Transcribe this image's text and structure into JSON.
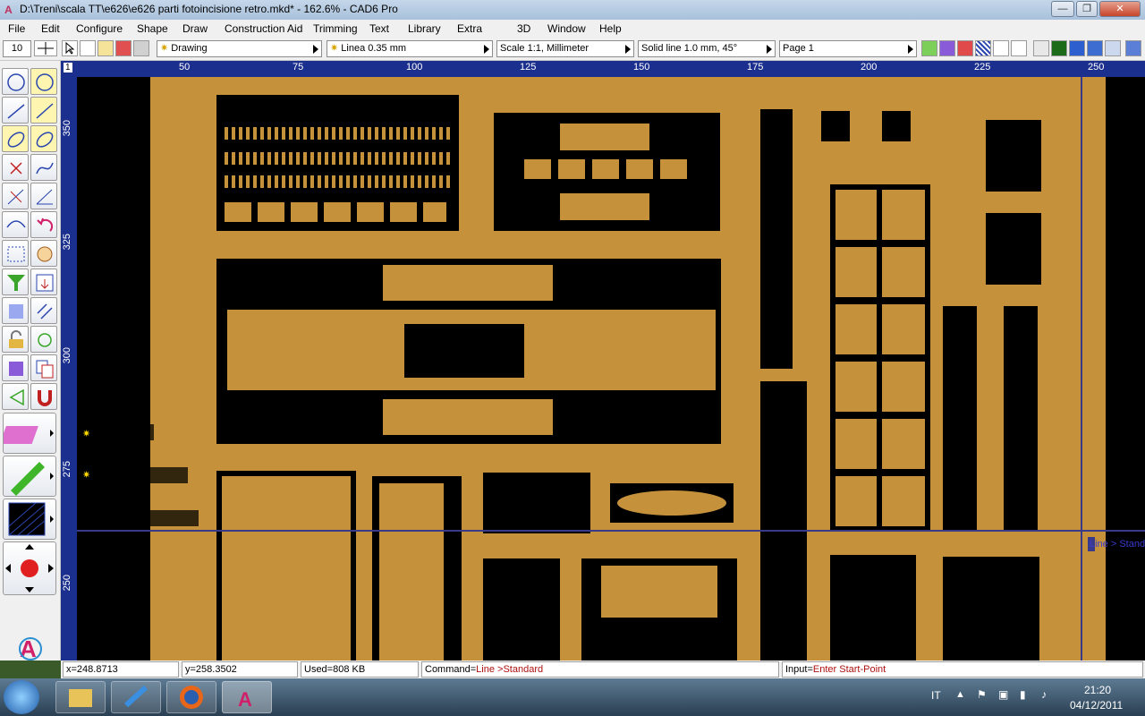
{
  "window": {
    "title": "D:\\Treni\\scala TT\\e626\\e626 parti fotoincisione retro.mkd* - 162.6% - CAD6 Pro",
    "min": "—",
    "max": "❐",
    "close": "✕"
  },
  "menu": [
    "File",
    "Edit",
    "Configure",
    "Shape",
    "Draw",
    "Construction Aid",
    "Trimming",
    "Text",
    "Library",
    "Extra",
    "3D",
    "Window",
    "Help"
  ],
  "toolbar": {
    "snap_value": "10",
    "layer": "Drawing",
    "pen": "Linea 0.35 mm",
    "scale": "Scale 1:1, Millimeter",
    "hatch": "Solid line 1.0 mm, 45°",
    "page": "Page 1"
  },
  "ruler": {
    "h_labels": [
      "50",
      "75",
      "100",
      "125",
      "150",
      "175",
      "200",
      "225",
      "250"
    ],
    "v_labels": [
      "350",
      "325",
      "300",
      "275",
      "250"
    ],
    "corner": "1"
  },
  "cursor_label": "Line > Standard",
  "status": {
    "x": "x=248.8713",
    "y": "y=258.3502",
    "used": "Used=808 KB",
    "command_label": "Command=",
    "command_value": "Line >Standard",
    "input_label": "Input=",
    "input_value": "Enter Start-Point"
  },
  "taskbar": {
    "lang": "IT",
    "time": "21:20",
    "date": "04/12/2011"
  },
  "colors": {
    "sheet": "#c6913b",
    "ruler": "#1b2f8e",
    "canvas": "#000000"
  }
}
